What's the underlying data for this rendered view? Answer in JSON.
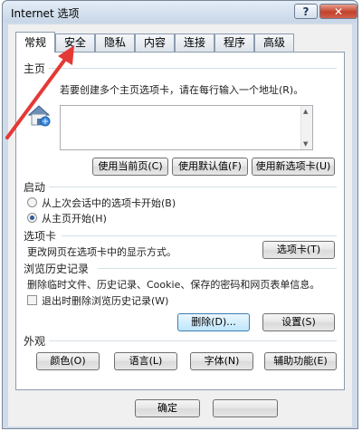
{
  "window": {
    "title": "Internet 选项",
    "help": "?",
    "close": "✕"
  },
  "tabs": [
    "常规",
    "安全",
    "隐私",
    "内容",
    "连接",
    "程序",
    "高级"
  ],
  "active_tab": "常规",
  "homepage": {
    "title": "主页",
    "instruction": "若要创建多个主页选项卡，请在每行输入一个地址(R)。",
    "value": "",
    "buttons": {
      "current": "使用当前页(C)",
      "default": "使用默认值(F)",
      "new_tab": "使用新选项卡(U)"
    }
  },
  "startup": {
    "title": "启动",
    "option_last_session": "从上次会话中的选项卡开始(B)",
    "option_homepage": "从主页开始(H)",
    "selected": "option_homepage"
  },
  "tabs_section": {
    "title": "选项卡",
    "description": "更改网页在选项卡中的显示方式。",
    "button": "选项卡(T)"
  },
  "history": {
    "title": "浏览历史记录",
    "description": "删除临时文件、历史记录、Cookie、保存的密码和网页表单信息。",
    "checkbox": "退出时删除浏览历史记录(W)",
    "checkbox_checked": false,
    "delete_button": "删除(D)...",
    "settings_button": "设置(S)"
  },
  "appearance": {
    "title": "外观",
    "colors": "颜色(O)",
    "languages": "语言(L)",
    "fonts": "字体(N)",
    "accessibility": "辅助功能(E)"
  },
  "footer": {
    "ok": "确定",
    "cancel": ""
  },
  "colors": {
    "annotation_arrow": "#e53935",
    "title_bar": "#c7d6e7",
    "close_button": "#c2412b"
  }
}
